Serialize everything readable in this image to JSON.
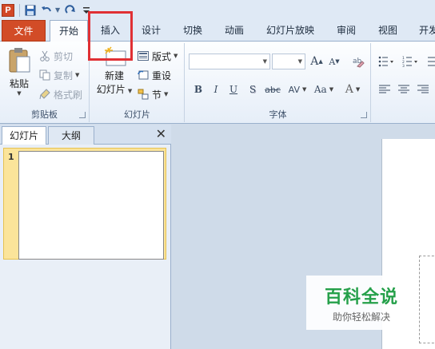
{
  "app": {
    "icon_letter": "P"
  },
  "tabs": [
    "文件",
    "开始",
    "插入",
    "设计",
    "切换",
    "动画",
    "幻灯片放映",
    "审阅",
    "视图",
    "开发"
  ],
  "clipboard": {
    "paste": "粘贴",
    "cut": "剪切",
    "copy": "复制",
    "format_painter": "格式刷",
    "label": "剪贴板"
  },
  "slides": {
    "new_slide_line1": "新建",
    "new_slide_line2": "幻灯片",
    "layout": "版式",
    "reset": "重设",
    "section": "节",
    "label": "幻灯片"
  },
  "font": {
    "grow": "A",
    "shrink": "A",
    "bold": "B",
    "italic": "I",
    "underline": "U",
    "shadow": "S",
    "strike": "abc",
    "spacing": "AV",
    "case": "Aa",
    "color": "A",
    "label": "字体"
  },
  "panel": {
    "tab_slides": "幻灯片",
    "tab_outline": "大纲",
    "close": "✕",
    "slide_number": "1"
  },
  "watermark": {
    "title": "百科全说",
    "subtitle": "助你轻松解决"
  },
  "colors": {
    "file_tab": "#d24c27",
    "highlight": "#e03034",
    "watermark_green": "#25a04a"
  }
}
